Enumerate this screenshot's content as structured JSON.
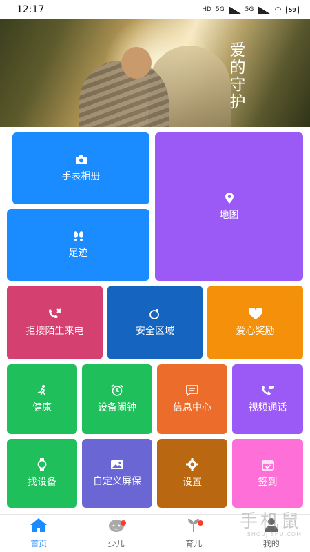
{
  "status_bar": {
    "time": "12:17",
    "net": "HD",
    "sig1": "5G",
    "sig2": "5G",
    "battery": "59"
  },
  "hero": {
    "title": "爱的守护"
  },
  "tiles": [
    {
      "label": "手表相册",
      "icon": "camera-icon",
      "color": "#1a8cff"
    },
    {
      "label": "地图",
      "icon": "location-pin-icon",
      "color": "#9b59f5"
    },
    {
      "label": "足迹",
      "icon": "footprints-icon",
      "color": "#1a8cff"
    },
    {
      "label": "拒接陌生来电",
      "icon": "blocked-call-icon",
      "color": "#d4406f"
    },
    {
      "label": "安全区域",
      "icon": "safe-zone-icon",
      "color": "#1565c0"
    },
    {
      "label": "爱心奖励",
      "icon": "heart-icon",
      "color": "#f5900a"
    },
    {
      "label": "健康",
      "icon": "running-icon",
      "color": "#1fbf5b"
    },
    {
      "label": "设备闹钟",
      "icon": "alarm-clock-icon",
      "color": "#1fbf5b"
    },
    {
      "label": "信息中心",
      "icon": "message-icon",
      "color": "#ec6c2c"
    },
    {
      "label": "视频通话",
      "icon": "video-call-icon",
      "color": "#9b59f5"
    },
    {
      "label": "找设备",
      "icon": "watch-icon",
      "color": "#1fbf5b"
    },
    {
      "label": "自定义屏保",
      "icon": "image-icon",
      "color": "#6a67d4"
    },
    {
      "label": "设置",
      "icon": "gear-icon",
      "color": "#b96710"
    },
    {
      "label": "签到",
      "icon": "calendar-check-icon",
      "color": "#ff6fd8"
    }
  ],
  "nav": [
    {
      "label": "首页",
      "icon": "home-icon"
    },
    {
      "label": "少儿",
      "icon": "child-face-icon"
    },
    {
      "label": "育儿",
      "icon": "sprout-icon"
    },
    {
      "label": "我的",
      "icon": "person-icon"
    }
  ],
  "watermark": {
    "text": "手机鼠",
    "sub": "SHOUJISHU.COM"
  }
}
